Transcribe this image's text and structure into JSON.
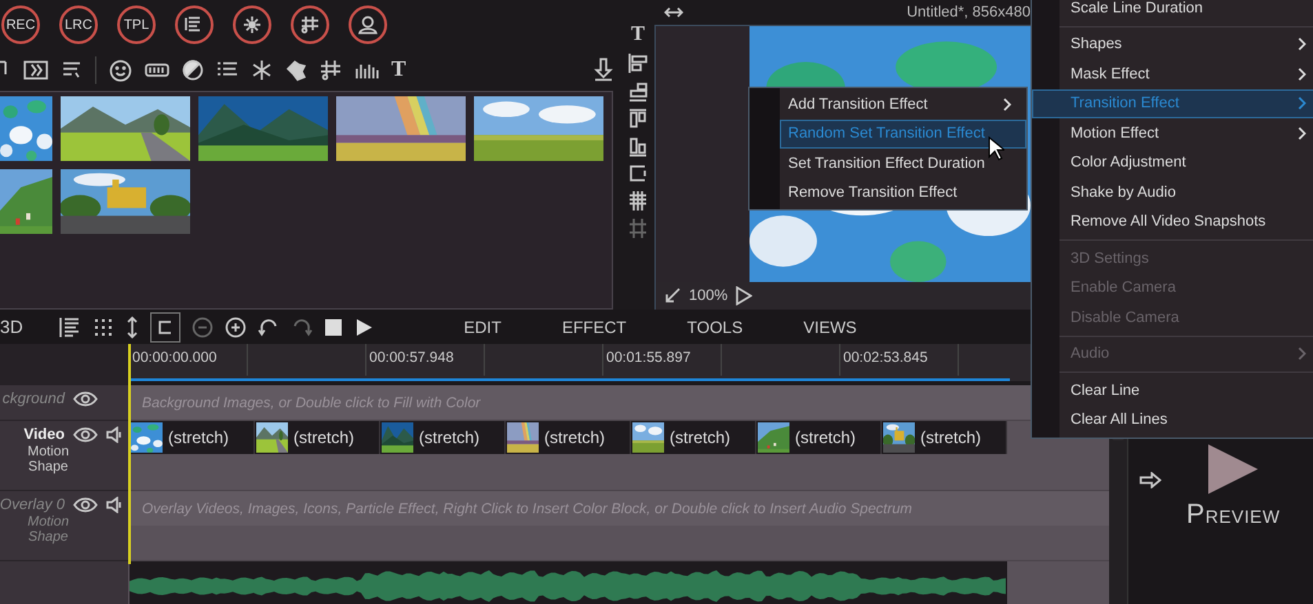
{
  "media_panel": {
    "record_buttons": [
      "REC",
      "LRC",
      "TPL"
    ],
    "toolbar_text_icon": "T",
    "thumbnails": [
      {
        "kind": "picture"
      },
      {
        "kind": "picture"
      },
      {
        "kind": "picture"
      },
      {
        "kind": "picture"
      },
      {
        "kind": "picture"
      },
      {
        "kind": "picture"
      },
      {
        "kind": "picture"
      }
    ]
  },
  "side_tools": {
    "text_icon": "T"
  },
  "preview": {
    "title": "Untitled*, 856x480",
    "zoom": "100%"
  },
  "timeline": {
    "partial_label": "3D",
    "tabs": [
      {
        "label": "EDIT"
      },
      {
        "label": "EFFECT"
      },
      {
        "label": "TOOLS"
      },
      {
        "label": "VIEWS"
      }
    ],
    "ruler": [
      "00:00:00.000",
      "00:00:57.948",
      "00:01:55.897",
      "00:02:53.845"
    ],
    "tracks": [
      {
        "kind": "background",
        "label": "ckground",
        "hint": "Background Images, or Double click to Fill with Color"
      },
      {
        "kind": "video",
        "label": "Video",
        "sublabel": "Motion Shape",
        "clips": [
          {
            "label": "(stretch)"
          },
          {
            "label": "(stretch)"
          },
          {
            "label": "(stretch)"
          },
          {
            "label": "(stretch)"
          },
          {
            "label": "(stretch)"
          },
          {
            "label": "(stretch)"
          },
          {
            "label": "(stretch)"
          }
        ]
      },
      {
        "kind": "overlay",
        "label": "Overlay 0",
        "sublabel": "Motion Shape",
        "hint": "Overlay Videos, Images, Icons, Particle Effect, Right Click to Insert Color Block, or Double click to Insert Audio Spectrum"
      },
      {
        "kind": "audio"
      }
    ]
  },
  "preview_button": {
    "label": "PREVIEW"
  },
  "context_menu": {
    "groups": [
      [
        {
          "label": "Scale Line Duration",
          "submenu": false,
          "selected": false,
          "disabled": false
        }
      ],
      [
        {
          "label": "Shapes",
          "submenu": true,
          "selected": false,
          "disabled": false
        },
        {
          "label": "Mask Effect",
          "submenu": true,
          "selected": false,
          "disabled": false
        },
        {
          "label": "Transition Effect",
          "submenu": true,
          "selected": true,
          "disabled": false
        },
        {
          "label": "Motion Effect",
          "submenu": true,
          "selected": false,
          "disabled": false
        },
        {
          "label": "Color Adjustment",
          "submenu": false,
          "selected": false,
          "disabled": false
        },
        {
          "label": "Shake by Audio",
          "submenu": false,
          "selected": false,
          "disabled": false
        },
        {
          "label": "Remove All Video Snapshots",
          "submenu": false,
          "selected": false,
          "disabled": false
        }
      ],
      [
        {
          "label": "3D Settings",
          "submenu": false,
          "selected": false,
          "disabled": true
        },
        {
          "label": "Enable Camera",
          "submenu": false,
          "selected": false,
          "disabled": true
        },
        {
          "label": "Disable Camera",
          "submenu": false,
          "selected": false,
          "disabled": true
        }
      ],
      [
        {
          "label": "Audio",
          "submenu": true,
          "selected": false,
          "disabled": true
        }
      ],
      [
        {
          "label": "Clear Line",
          "submenu": false,
          "selected": false,
          "disabled": false
        },
        {
          "label": "Clear All Lines",
          "submenu": false,
          "selected": false,
          "disabled": false
        }
      ]
    ]
  },
  "submenu": {
    "items": [
      {
        "label": "Add Transition Effect",
        "submenu": true,
        "selected": false
      },
      {
        "label": "Random Set Transition Effect",
        "submenu": false,
        "selected": true
      },
      {
        "label": "Set Transition Effect Duration",
        "submenu": false,
        "selected": false
      },
      {
        "label": "Remove Transition Effect",
        "submenu": false,
        "selected": false
      }
    ]
  }
}
